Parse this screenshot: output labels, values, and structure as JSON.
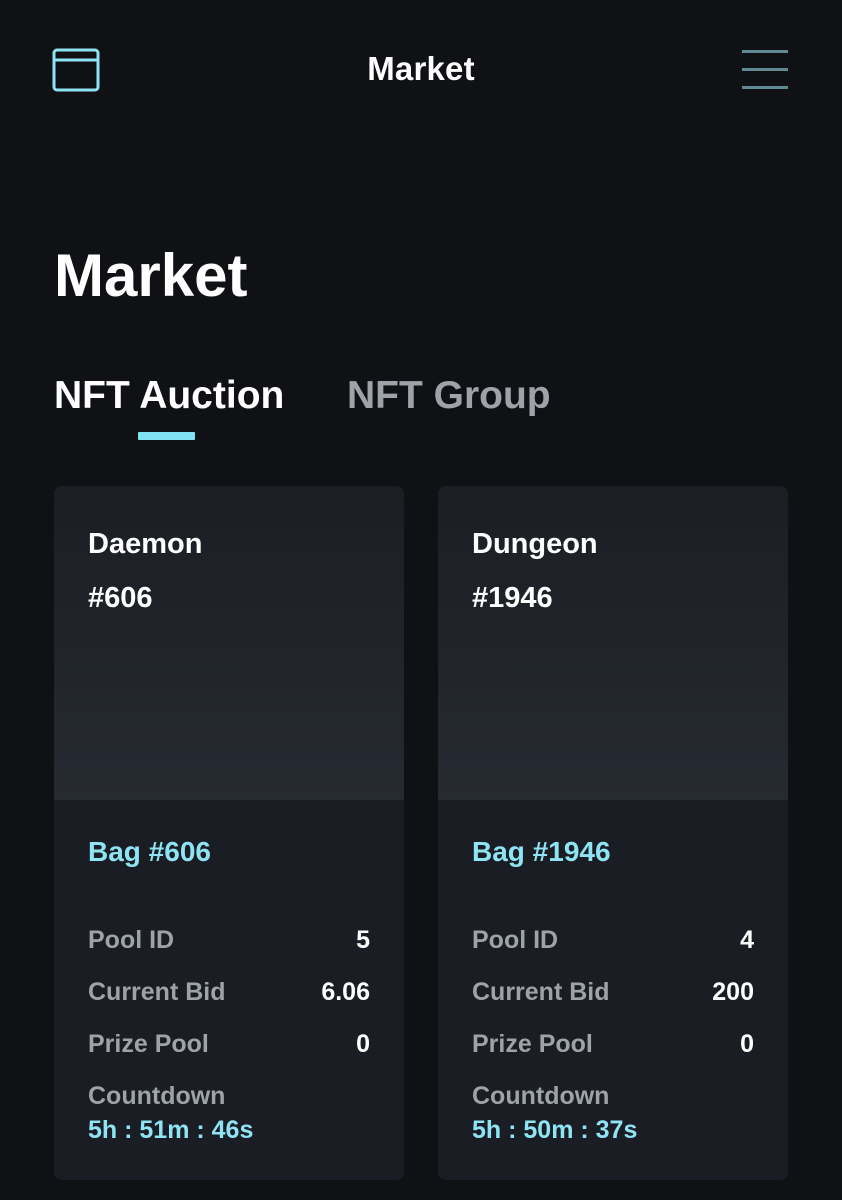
{
  "header": {
    "title": "Market",
    "left_icon": "wallet-icon",
    "right_icon": "menu-icon"
  },
  "page_title": "Market",
  "tabs": [
    {
      "label": "NFT Auction",
      "active": true
    },
    {
      "label": "NFT Group",
      "active": false
    }
  ],
  "cards": [
    {
      "name": "Daemon",
      "number": "#606",
      "bag": "Bag #606",
      "pool_id_label": "Pool ID",
      "pool_id": "5",
      "current_bid_label": "Current Bid",
      "current_bid": "6.06",
      "prize_pool_label": "Prize Pool",
      "prize_pool": "0",
      "countdown_label": "Countdown",
      "countdown": "5h : 51m : 46s"
    },
    {
      "name": "Dungeon",
      "number": "#1946",
      "bag": "Bag #1946",
      "pool_id_label": "Pool ID",
      "pool_id": "4",
      "current_bid_label": "Current Bid",
      "current_bid": "200",
      "prize_pool_label": "Prize Pool",
      "prize_pool": "0",
      "countdown_label": "Countdown",
      "countdown": "5h : 50m : 37s"
    }
  ],
  "colors": {
    "background": "#0f1115",
    "card": "#1a1d23",
    "accent": "#8fe4f4",
    "muted_text": "#9ea3a9"
  }
}
